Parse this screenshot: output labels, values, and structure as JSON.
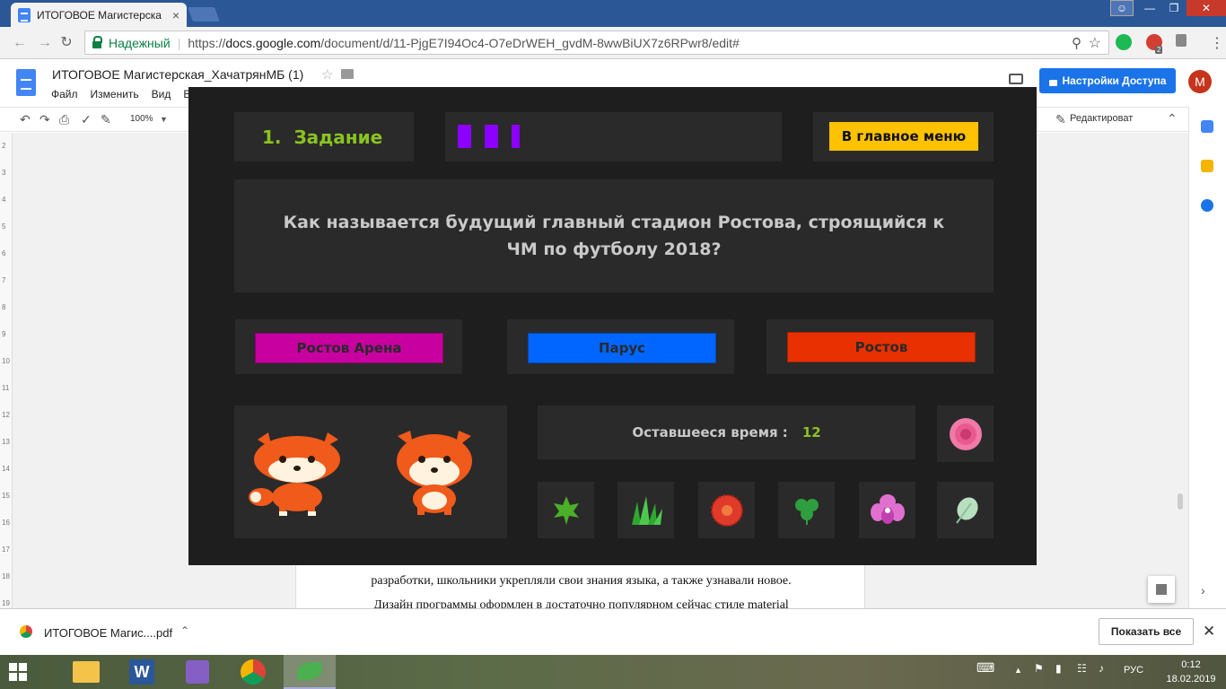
{
  "browser": {
    "tab_title": "ИТОГОВОЕ Магистерска",
    "tab_close": "×",
    "security_label": "Надежный",
    "url_prefix": "https://",
    "url_host": "docs.google.com",
    "url_path": "/document/d/11-PjgE7I94Oc4-O7eDrWEH_gvdM-8wwBiUX7z6RPwr8/edit#",
    "ext_badge": "2"
  },
  "docs": {
    "title": "ИТОГОВОЕ Магистерская_ХачатрянМБ (1)",
    "menu": [
      "Файл",
      "Изменить",
      "Вид",
      "Вст"
    ],
    "share_label": "Настройки Доступа",
    "avatar_initial": "М",
    "zoom": "100%",
    "mode": "Редактироват",
    "text_line1": "разработки, школьники укрепляли свои знания языка, а также узнавали новое.",
    "text_line2": "Дизайн программы оформлен в достаточно популярном сейчас стиле material"
  },
  "ruler_marks": [
    "2",
    "3",
    "4",
    "5",
    "6",
    "7",
    "8",
    "9",
    "10",
    "11",
    "12",
    "13",
    "14",
    "15",
    "16",
    "17",
    "18",
    "19"
  ],
  "quiz": {
    "question_number": "1.",
    "task_label": "Задание",
    "progress_segments": 3,
    "menu_button": "В главное меню",
    "question": "Как называется будущий главный стадион Ростова, строящийся к ЧМ по футболу 2018?",
    "answers": [
      {
        "label": "Ростов Арена",
        "color": "#c800a0"
      },
      {
        "label": "Парус",
        "color": "#0066ff"
      },
      {
        "label": "Ростов",
        "color": "#e83000"
      }
    ],
    "timer_label": "Оставшееся время :",
    "timer_value": "12",
    "accent_color": "#8bc320",
    "progress_color": "#8b00ff",
    "tiles": [
      "rose-icon",
      "maple-leaf-icon",
      "grass-icon",
      "red-flower-icon",
      "clover-icon",
      "orchid-icon",
      "pale-leaf-icon"
    ]
  },
  "downloads": {
    "file_name": "ИТОГОВОЕ Магис....pdf",
    "show_all": "Показать все"
  },
  "taskbar": {
    "language": "РУС",
    "time": "0:12",
    "date": "18.02.2019"
  }
}
